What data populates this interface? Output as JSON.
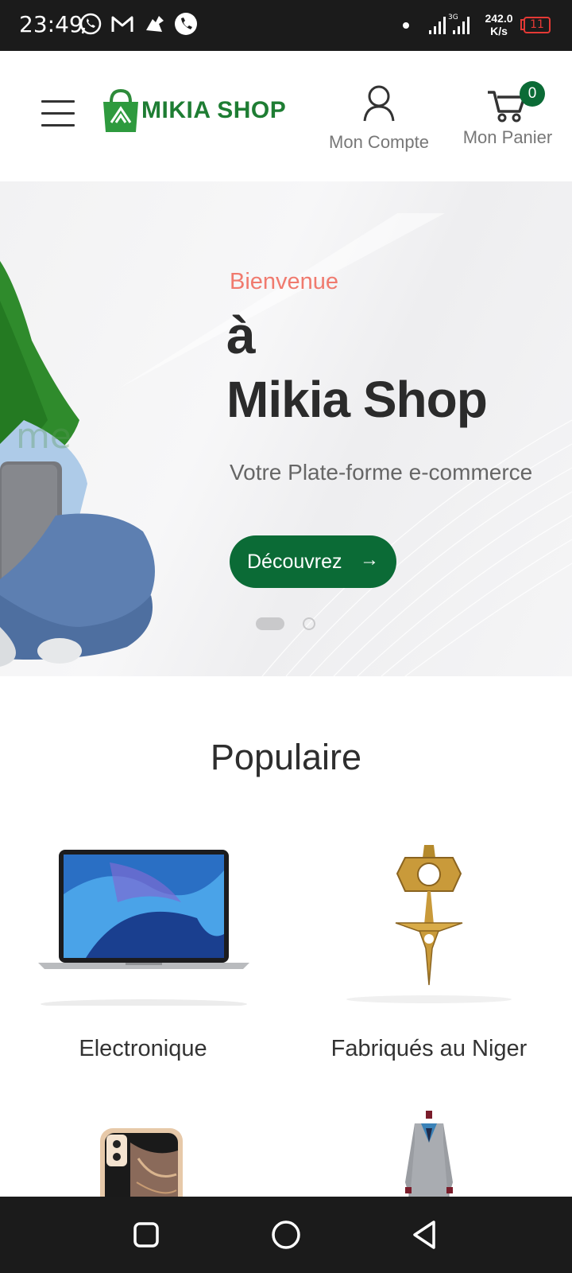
{
  "status_bar": {
    "time": "23:49",
    "network_speed_value": "242.0",
    "network_speed_unit": "K/s",
    "battery": "11",
    "icons": [
      "whatsapp-icon",
      "gmail-icon",
      "app-icon",
      "phone-call-icon",
      "signal-icon",
      "battery-icon"
    ]
  },
  "header": {
    "logo_text": "MIKIA SHOP",
    "account_label": "Mon Compte",
    "cart_label": "Mon Panier",
    "cart_count": "0"
  },
  "hero": {
    "eyebrow": "Bienvenue",
    "title_line1": "à",
    "title_line2": "Mikia Shop",
    "subtitle": "Votre Plate-forme e-commerce",
    "cta_label": "Découvrez",
    "cta_arrow": "→",
    "slides_total": 2,
    "active_slide": 1
  },
  "popular": {
    "title": "Populaire",
    "categories": [
      {
        "label": "Electronique",
        "image": "laptop"
      },
      {
        "label": "Fabriqués au Niger",
        "image": "pendant"
      },
      {
        "label": "",
        "image": "smartphone"
      },
      {
        "label": "",
        "image": "suit"
      }
    ]
  },
  "colors": {
    "brand_green": "#0b6b36",
    "logo_green": "#1e7d33",
    "accent_coral": "#f07a6e"
  }
}
